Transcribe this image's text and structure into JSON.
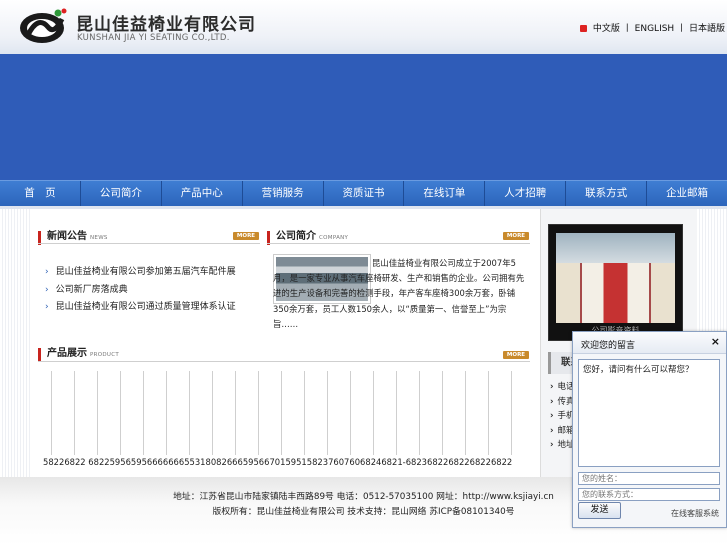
{
  "header": {
    "company_cn": "昆山佳益椅业有限公司",
    "company_en": "KUNSHAN JIA YI SEATING CO.,LTD.",
    "lang_links": [
      "中文版",
      "ENGLISH",
      "日本語版"
    ],
    "lang_sep": "丨"
  },
  "nav": {
    "items": [
      "首　页",
      "公司简介",
      "产品中心",
      "营销服务",
      "资质证书",
      "在线订单",
      "人才招聘",
      "联系方式",
      "企业邮箱"
    ]
  },
  "news": {
    "title": "新闻公告",
    "title_en": "NEWS",
    "more": "MORE",
    "items": [
      "昆山佳益椅业有限公司参加第五届汽车配件展",
      "公司新厂房落成典",
      "昆山佳益椅业有限公司通过质量管理体系认证"
    ]
  },
  "about": {
    "title": "公司简介",
    "title_en": "COMPANY",
    "more": "MORE",
    "text": "昆山佳益椅业有限公司成立于2007年5月，是一家专业从事汽车座椅研发、生产和销售的企业。公司拥有先进的生产设备和完善的检测手段，年产客车座椅300余万套，卧铺350余万套，员工人数150余人，以“质量第一、信誉至上”为宗旨……"
  },
  "products": {
    "title": "产品展示",
    "title_en": "PRODUCT",
    "more": "MORE",
    "serials": "58226822 68225956595666666655318082666595667015951582376076068246821-68236822682268226822"
  },
  "right": {
    "video_caption": "公司影音资料",
    "contact_title": "联系我们",
    "contact_items": [
      "电话：0512",
      "传真：0512",
      "手机：139",
      "邮箱：ksjy",
      "地址：昆山"
    ]
  },
  "footer": {
    "line1": "地址：江苏省昆山市陆家镇陆丰西路89号 电话：0512-57035100 网址：http://www.ksjiayi.cn",
    "line2": "版权所有：昆山佳益椅业有限公司  技术支持：昆山网络 苏ICP备08101340号"
  },
  "chat": {
    "title": "欢迎您的留言",
    "close": "×",
    "message": "您好，请问有什么可以帮您？",
    "name_placeholder": "您的姓名：",
    "phone_placeholder": "您的联系方式：",
    "send": "发送",
    "powered": "在线客服系统"
  },
  "colors": {
    "banner": "#2f5cb8",
    "nav": "#2c65bb",
    "accent_red": "#c8241e",
    "more_badge": "#c98a2b"
  }
}
